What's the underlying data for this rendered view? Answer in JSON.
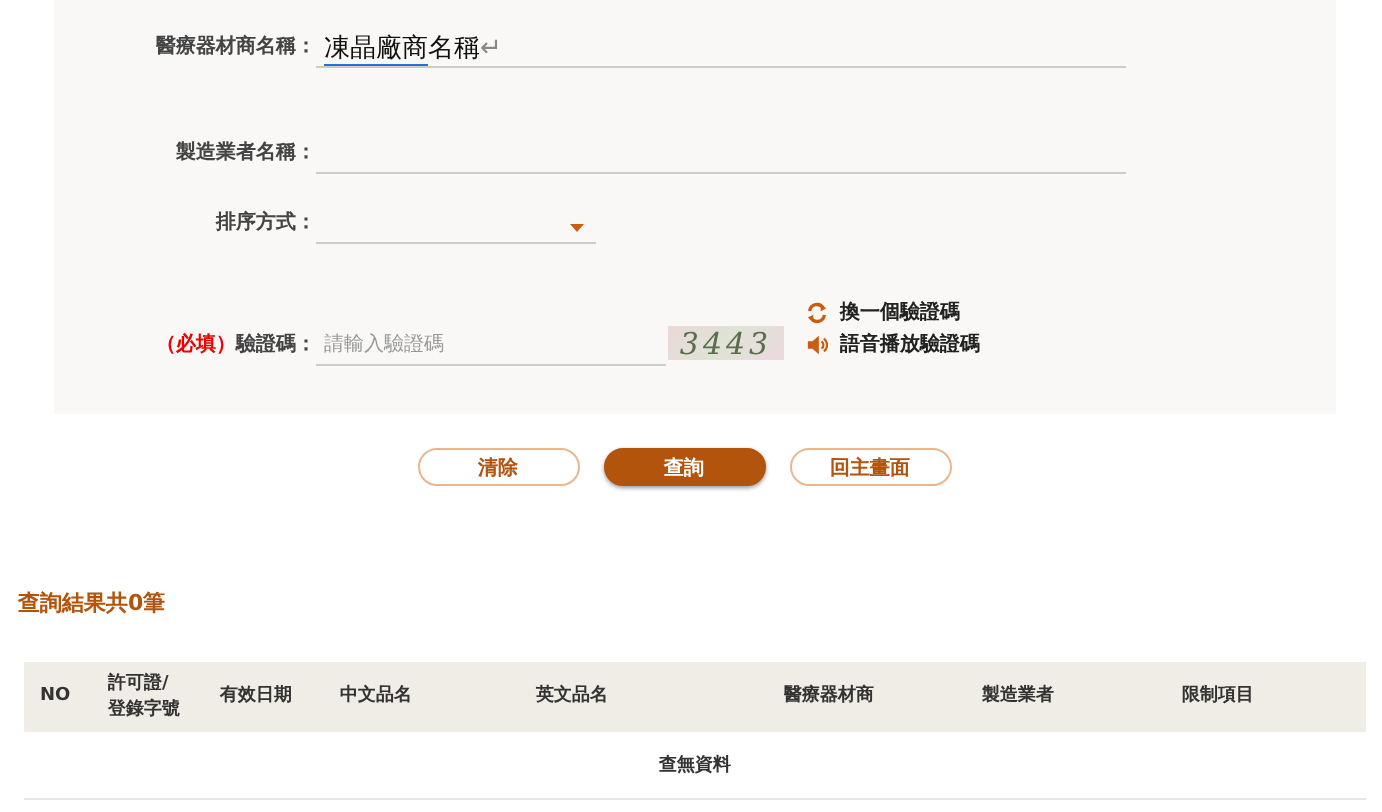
{
  "form": {
    "fields": [
      {
        "kind": "text",
        "label": "醫療器材商名稱：",
        "composing_text": "凍晶廠商",
        "value": "名稱",
        "return_mark": "↵"
      },
      {
        "kind": "text",
        "label": "製造業者名稱："
      },
      {
        "kind": "select",
        "label": "排序方式："
      },
      {
        "kind": "captcha",
        "required": "（必填）",
        "label": "驗證碼：",
        "placeholder": "請輸入驗證碼",
        "captcha_text": "3443",
        "links": [
          "換一個驗證碼",
          "語音播放驗證碼"
        ]
      }
    ]
  },
  "buttons": [
    {
      "label": "清除",
      "primary": false
    },
    {
      "label": "查詢",
      "primary": true
    },
    {
      "label": "回主畫面",
      "primary": false
    }
  ],
  "results": {
    "title": "查詢結果共0筆",
    "columns": [
      "NO",
      "許可證/\n登錄字號",
      "有效日期",
      "中文品名",
      "英文品名",
      "醫療器材商",
      "製造業者",
      "限制項目"
    ],
    "empty_message": "查無資料"
  }
}
